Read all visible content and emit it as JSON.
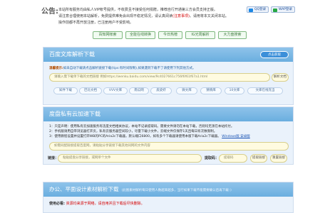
{
  "notice": {
    "title": "公告:",
    "line1": "本站所有服务均由私人VIP帐号提供，不收费且不接受任何捐赠，推荐自行开通第三方会员支持正版。",
    "line2": "请注意合理使用本站解析，免费提供难免会出现不稳定情况，请认真阅读",
    "line2_link": "(注意事项)",
    "line2_end": "。请用将本又关闭本站。",
    "line3": "操作前都不再开放注册，已注册用户不受影响。",
    "qq_btn": "QQ登录",
    "wx_btn": "WAP登录"
  },
  "quick_links": [
    "百知网帐索",
    "全能在线转换",
    "今日热榜",
    "IG光周解析",
    "大力盘搜索"
  ],
  "wenku": {
    "title": "百度文库解析下载",
    "parse_btn": "点击获取",
    "tip_label": "温馨提示:",
    "tip_text": "如未自动下载请点击解析链接下载(tips:有时间限制),如果遇到下载不了请使用下列其他方式。",
    "input_placeholder": "请输入需下载单下载的文档链接 例如https://wenku.baidu.com/view/9c4027661c756f6f61f67a1.html",
    "submit": "解析文档",
    "libraries": [
      "知件下载",
      "巴比文档",
      "VVV文库",
      "南瓜网",
      "皮皮虾",
      "微文库",
      "猜情库",
      "10文库",
      "文库在线充当"
    ]
  },
  "pan": {
    "title": "度盘私有云加速下载",
    "note1": "1：只是声明：使用私有云加速服务有违度文档相关协议，本站不记录提取码。需要文件请勿在本站下载，否则均无须在本站托付。",
    "note2": "2：手机版请用自带浏览器打开页，私有云服务器空间较小，尽量下载小文件，云端文件仅保存1天且每日有次数限制。",
    "note3": "3：使用教程设置并设置打开WB的PC的Aria2c下载器，默认端口6800，如有多个下载器请使用本版下载Aria2c下载器。",
    "note3_link": "Windows版 安卓版",
    "share_placeholder": "如需同配链接提取百度网，请粘贴分享链接下载其他同网的文件内容",
    "link_label": "链接：",
    "link_placeholder": "粘贴提盘分享链接，或网单个文件",
    "code_label": "提取码：",
    "code_placeholder": "提取码",
    "get_btn": "提取链接",
    "reset_btn": "重置链接"
  },
  "office": {
    "title": "办公、平面设计素材解析下载",
    "subtitle": "(此图素材解析每日使用人数越来越多，当行如果下载不能需要确认后再下载：)",
    "body_label": "使用必看:",
    "body_text": "资源均来源于网络，请自用并且下载后尽快删除。"
  },
  "colors": {
    "panel_header": "#7ab8e4",
    "input_bg": "#fffbe0",
    "notice_red": "#d40000",
    "button_blue": "#3b8fd9"
  }
}
